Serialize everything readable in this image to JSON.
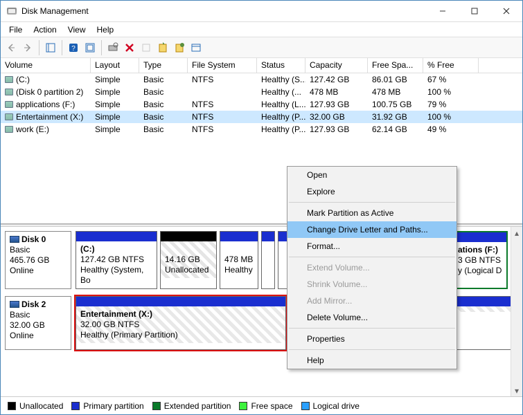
{
  "window": {
    "title": "Disk Management"
  },
  "menus": {
    "file": "File",
    "action": "Action",
    "view": "View",
    "help": "Help"
  },
  "table": {
    "headers": {
      "volume": "Volume",
      "layout": "Layout",
      "type": "Type",
      "file_system": "File System",
      "status": "Status",
      "capacity": "Capacity",
      "free_space": "Free Spa...",
      "pct_free": "% Free"
    },
    "rows": [
      {
        "volume": "(C:)",
        "layout": "Simple",
        "type": "Basic",
        "fs": "NTFS",
        "status": "Healthy (S...",
        "capacity": "127.42 GB",
        "free": "86.01 GB",
        "pct": "67 %"
      },
      {
        "volume": "(Disk 0 partition 2)",
        "layout": "Simple",
        "type": "Basic",
        "fs": "",
        "status": "Healthy (...",
        "capacity": "478 MB",
        "free": "478 MB",
        "pct": "100 %"
      },
      {
        "volume": "applications (F:)",
        "layout": "Simple",
        "type": "Basic",
        "fs": "NTFS",
        "status": "Healthy (L...",
        "capacity": "127.93 GB",
        "free": "100.75 GB",
        "pct": "79 %"
      },
      {
        "volume": "Entertainment (X:)",
        "layout": "Simple",
        "type": "Basic",
        "fs": "NTFS",
        "status": "Healthy (P...",
        "capacity": "32.00 GB",
        "free": "31.92 GB",
        "pct": "100 %"
      },
      {
        "volume": "work (E:)",
        "layout": "Simple",
        "type": "Basic",
        "fs": "NTFS",
        "status": "Healthy (P...",
        "capacity": "127.93 GB",
        "free": "62.14 GB",
        "pct": "49 %"
      }
    ]
  },
  "disks": {
    "d0": {
      "name": "Disk 0",
      "type": "Basic",
      "size": "465.76 GB",
      "status": "Online",
      "parts": {
        "p0": {
          "title": "(C:)",
          "line2": "127.42 GB NTFS",
          "line3": "Healthy (System, Bo"
        },
        "p1": {
          "title": "",
          "line2": "14.16 GB",
          "line3": "Unallocated"
        },
        "p2": {
          "title": "",
          "line2": "478 MB",
          "line3": "Healthy"
        },
        "p5": {
          "title": "ations  (F:)",
          "line2": "3 GB NTFS",
          "line3": "y (Logical D"
        }
      }
    },
    "d2": {
      "name": "Disk 2",
      "type": "Basic",
      "size": "32.00 GB",
      "status": "Online",
      "parts": {
        "p0": {
          "title": "Entertainment  (X:)",
          "line2": "32.00 GB NTFS",
          "line3": "Healthy (Primary Partition)"
        }
      }
    }
  },
  "legend": {
    "unallocated": "Unallocated",
    "primary": "Primary partition",
    "extended": "Extended partition",
    "free": "Free space",
    "logical": "Logical drive"
  },
  "context_menu": {
    "open": "Open",
    "explore": "Explore",
    "mark_active": "Mark Partition as Active",
    "change_letter": "Change Drive Letter and Paths...",
    "format": "Format...",
    "extend": "Extend Volume...",
    "shrink": "Shrink Volume...",
    "add_mirror": "Add Mirror...",
    "delete": "Delete Volume...",
    "properties": "Properties",
    "help": "Help"
  }
}
